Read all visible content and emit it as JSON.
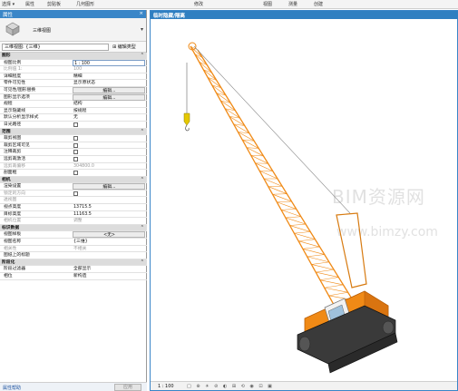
{
  "ribbon": {
    "items": [
      "选择 ▾",
      "属性",
      "剪贴板",
      "几何图形",
      "修改",
      "视图",
      "测量",
      "创建"
    ]
  },
  "properties": {
    "title": "属性",
    "close": "×",
    "type_name": "三维视图",
    "instance_selector": "三维视图: {三维}",
    "edit_type_label": "编辑类型",
    "rows": [
      {
        "k": "图形",
        "sec": true
      },
      {
        "k": "视图比例",
        "v": "1 : 100",
        "style": "inp"
      },
      {
        "k": "比例值 1:",
        "v": "100",
        "dim": true
      },
      {
        "k": "详细程度",
        "v": "精细"
      },
      {
        "k": "零件可见性",
        "v": "显示原状态"
      },
      {
        "k": "可见性/图形替换",
        "v": "编辑...",
        "style": "btn"
      },
      {
        "k": "图形显示选项",
        "v": "编辑...",
        "style": "btn"
      },
      {
        "k": "规程",
        "v": "结构"
      },
      {
        "k": "显示隐藏线",
        "v": "按规程"
      },
      {
        "k": "默认分析显示样式",
        "v": "无"
      },
      {
        "k": "日光路径",
        "cb": true
      },
      {
        "k": "范围",
        "sec": true
      },
      {
        "k": "裁剪视图",
        "cb": true
      },
      {
        "k": "裁剪区域可见",
        "cb": true
      },
      {
        "k": "注释裁剪",
        "cb": true
      },
      {
        "k": "远剪裁激活",
        "cb": true
      },
      {
        "k": "远剪裁偏移",
        "v": "304800.0",
        "dim": true
      },
      {
        "k": "剖面框",
        "cb": true
      },
      {
        "k": "相机",
        "sec": true
      },
      {
        "k": "渲染设置",
        "v": "编辑...",
        "style": "btn"
      },
      {
        "k": "锁定的方向",
        "cb": true,
        "dim": true
      },
      {
        "k": "透视图",
        "dim": true
      },
      {
        "k": "视点高度",
        "v": "13715.5"
      },
      {
        "k": "目标高度",
        "v": "11163.5"
      },
      {
        "k": "相机位置",
        "v": "调整",
        "dim": true
      },
      {
        "k": "标识数据",
        "sec": true
      },
      {
        "k": "视图样板",
        "v": "<无>",
        "style": "btn"
      },
      {
        "k": "视图名称",
        "v": "{三维}"
      },
      {
        "k": "相关性",
        "v": "不相关",
        "dim": true
      },
      {
        "k": "图纸上的标题"
      },
      {
        "k": "阶段化",
        "sec": true
      },
      {
        "k": "阶段过滤器",
        "v": "全部显示"
      },
      {
        "k": "相位",
        "v": "新构造"
      }
    ],
    "help_link": "属性帮助",
    "apply_label": "应用"
  },
  "view": {
    "tab_title": "临时隐藏/隔离",
    "scale": "1 : 100",
    "bar_icons": "□ ⊕ ☀ ⊘ ◐ ⊞ ⟲ ◉ ⊡ ▣",
    "watermark": "BIM资源网",
    "watermark_url": "www.bimzy.com"
  },
  "colors": {
    "accent": "#2f7fc1",
    "crane": "#f08a16",
    "crane_dark": "#b85e08"
  }
}
